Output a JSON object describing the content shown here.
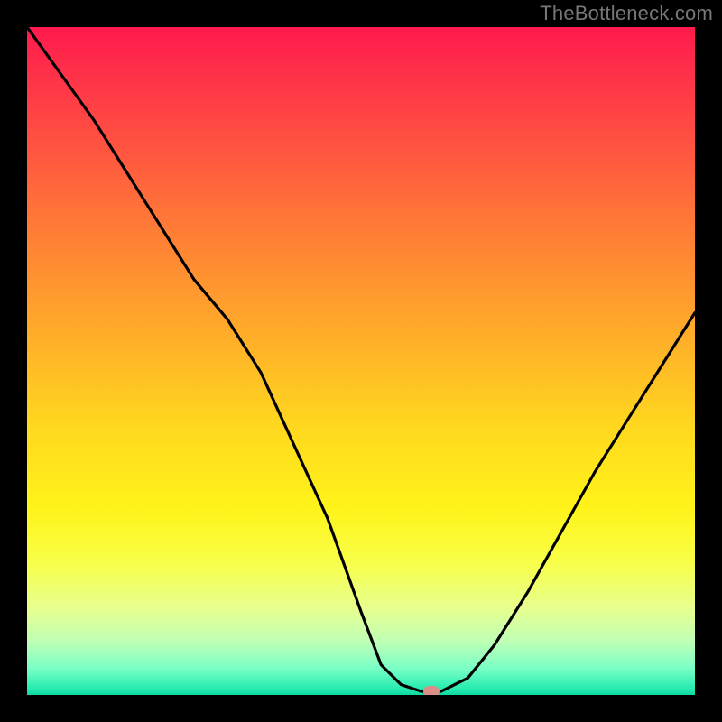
{
  "watermark": "TheBottleneck.com",
  "chart_data": {
    "type": "line",
    "title": "",
    "xlabel": "",
    "ylabel": "",
    "xlim": [
      0,
      1
    ],
    "ylim": [
      0,
      1
    ],
    "series": [
      {
        "name": "bottleneck-curve",
        "x": [
          0.0,
          0.05,
          0.1,
          0.15,
          0.2,
          0.25,
          0.3,
          0.35,
          0.4,
          0.45,
          0.5,
          0.53,
          0.56,
          0.59,
          0.62,
          0.66,
          0.7,
          0.75,
          0.8,
          0.85,
          0.9,
          0.95,
          1.0
        ],
        "y": [
          1.0,
          0.93,
          0.86,
          0.78,
          0.7,
          0.62,
          0.56,
          0.48,
          0.37,
          0.26,
          0.12,
          0.04,
          0.01,
          0.0,
          0.0,
          0.02,
          0.07,
          0.15,
          0.24,
          0.33,
          0.41,
          0.49,
          0.57
        ]
      }
    ],
    "marker": {
      "x": 0.605,
      "y": 0.0
    },
    "gradient_colors": {
      "top": "#ff1a4d",
      "mid": "#ffe01d",
      "bottom": "#0ed9a2"
    }
  }
}
